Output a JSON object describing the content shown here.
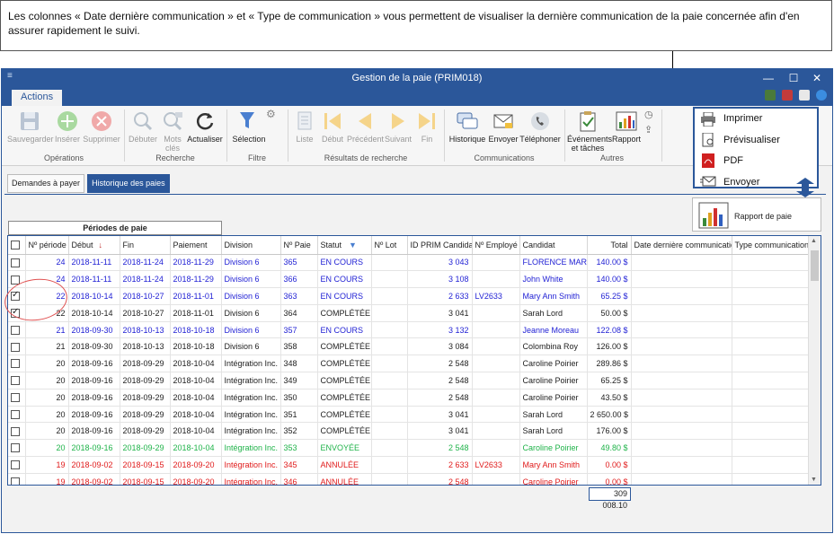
{
  "callout": {
    "text": "Les colonnes « Date dernière communication » et « Type de communication » vous permettent de visualiser la dernière communication de la paie concernée afin d'en assurer rapidement le suivi."
  },
  "window": {
    "title": "Gestion de la paie (PRIM018)",
    "controls": [
      "—",
      "☐",
      "✕"
    ],
    "ribbon_tab": "Actions"
  },
  "ribbon": {
    "groups": [
      {
        "label": "Opérations",
        "buttons": [
          "Sauvegarder",
          "Insérer",
          "Supprimer"
        ]
      },
      {
        "label": "Recherche",
        "buttons": [
          "Débuter",
          "Mots clés",
          "Actualiser"
        ]
      },
      {
        "label": "Filtre",
        "buttons": [
          "Sélection"
        ]
      },
      {
        "label": "Résultats de recherche",
        "buttons": [
          "Liste",
          "Début",
          "Précédent",
          "Suivant",
          "Fin"
        ]
      },
      {
        "label": "Communications",
        "buttons": [
          "Historique",
          "Envoyer",
          "Téléphoner"
        ]
      },
      {
        "label": "Autres",
        "buttons": [
          "Événements et tâches",
          "Rapport"
        ]
      }
    ]
  },
  "popup": {
    "items": [
      "Imprimer",
      "Prévisualiser",
      "PDF",
      "Envoyer"
    ],
    "rapport": "Rapport de paie"
  },
  "tabs": [
    "Demandes à payer",
    "Historique des paies"
  ],
  "grid": {
    "group_header": "Périodes de paie",
    "columns": [
      "",
      "Nº période",
      "Début",
      "Fin",
      "Paiement",
      "Division",
      "Nº Paie",
      "Statut",
      "Nº Lot",
      "ID PRIM Candidat",
      "Nº Employé",
      "Candidat",
      "Total",
      "Date dernière communication",
      "Type communication"
    ],
    "sort_icon": "↓",
    "filter_icon": "▼",
    "rows": [
      {
        "checked": false,
        "color": "blue",
        "cells": [
          "24",
          "2018-11-11",
          "2018-11-24",
          "2018-11-29",
          "Division 6",
          "365",
          "EN COURS",
          "",
          "3 043",
          "",
          "FLORENCE MARIN",
          "140.00 $",
          "",
          ""
        ]
      },
      {
        "checked": false,
        "color": "blue",
        "cells": [
          "24",
          "2018-11-11",
          "2018-11-24",
          "2018-11-29",
          "Division 6",
          "366",
          "EN COURS",
          "",
          "3 108",
          "",
          "John White",
          "140.00 $",
          "",
          ""
        ]
      },
      {
        "checked": true,
        "color": "blue",
        "cells": [
          "22",
          "2018-10-14",
          "2018-10-27",
          "2018-11-01",
          "Division 6",
          "363",
          "EN COURS",
          "",
          "2 633",
          "LV2633",
          "Mary Ann Smith",
          "65.25 $",
          "",
          ""
        ]
      },
      {
        "checked": true,
        "color": "black",
        "cells": [
          "22",
          "2018-10-14",
          "2018-10-27",
          "2018-11-01",
          "Division 6",
          "364",
          "COMPLÉTÉE",
          "",
          "3 041",
          "",
          "Sarah Lord",
          "50.00 $",
          "",
          ""
        ]
      },
      {
        "checked": false,
        "color": "blue",
        "cells": [
          "21",
          "2018-09-30",
          "2018-10-13",
          "2018-10-18",
          "Division 6",
          "357",
          "EN COURS",
          "",
          "3 132",
          "",
          "Jeanne Moreau",
          "122.08 $",
          "",
          ""
        ]
      },
      {
        "checked": false,
        "color": "black",
        "cells": [
          "21",
          "2018-09-30",
          "2018-10-13",
          "2018-10-18",
          "Division 6",
          "358",
          "COMPLÉTÉE",
          "",
          "3 084",
          "",
          "Colombina Roy",
          "126.00 $",
          "",
          ""
        ]
      },
      {
        "checked": false,
        "color": "black",
        "cells": [
          "20",
          "2018-09-16",
          "2018-09-29",
          "2018-10-04",
          "Intégration Inc.",
          "348",
          "COMPLÉTÉE",
          "",
          "2 548",
          "",
          "Caroline Poirier",
          "289.86 $",
          "",
          ""
        ]
      },
      {
        "checked": false,
        "color": "black",
        "cells": [
          "20",
          "2018-09-16",
          "2018-09-29",
          "2018-10-04",
          "Intégration Inc.",
          "349",
          "COMPLÉTÉE",
          "",
          "2 548",
          "",
          "Caroline Poirier",
          "65.25 $",
          "",
          ""
        ]
      },
      {
        "checked": false,
        "color": "black",
        "cells": [
          "20",
          "2018-09-16",
          "2018-09-29",
          "2018-10-04",
          "Intégration Inc.",
          "350",
          "COMPLÉTÉE",
          "",
          "2 548",
          "",
          "Caroline Poirier",
          "43.50 $",
          "",
          ""
        ]
      },
      {
        "checked": false,
        "color": "black",
        "cells": [
          "20",
          "2018-09-16",
          "2018-09-29",
          "2018-10-04",
          "Intégration Inc.",
          "351",
          "COMPLÉTÉE",
          "",
          "3 041",
          "",
          "Sarah Lord",
          "2 650.00 $",
          "",
          ""
        ]
      },
      {
        "checked": false,
        "color": "black",
        "cells": [
          "20",
          "2018-09-16",
          "2018-09-29",
          "2018-10-04",
          "Intégration Inc.",
          "352",
          "COMPLÉTÉE",
          "",
          "3 041",
          "",
          "Sarah Lord",
          "176.00 $",
          "",
          ""
        ]
      },
      {
        "checked": false,
        "color": "green",
        "cells": [
          "20",
          "2018-09-16",
          "2018-09-29",
          "2018-10-04",
          "Intégration Inc.",
          "353",
          "ENVOYÉE",
          "",
          "2 548",
          "",
          "Caroline Poirier",
          "49.80 $",
          "",
          ""
        ]
      },
      {
        "checked": false,
        "color": "red",
        "cells": [
          "19",
          "2018-09-02",
          "2018-09-15",
          "2018-09-20",
          "Intégration Inc.",
          "345",
          "ANNULÉE",
          "",
          "2 633",
          "LV2633",
          "Mary Ann Smith",
          "0.00 $",
          "",
          ""
        ]
      },
      {
        "checked": false,
        "color": "red",
        "cells": [
          "19",
          "2018-09-02",
          "2018-09-15",
          "2018-09-20",
          "Intégration Inc.",
          "346",
          "ANNULÉE",
          "",
          "2 548",
          "",
          "Caroline Poirier",
          "0.00 $",
          "",
          ""
        ]
      }
    ],
    "total": "309 008.10"
  },
  "colors": {
    "accent": "#2b579a",
    "status_in_progress": "#1f1fd4",
    "status_sent": "#20b34a",
    "status_cancelled": "#e01b1b",
    "highlight_circle": "#e05050"
  }
}
